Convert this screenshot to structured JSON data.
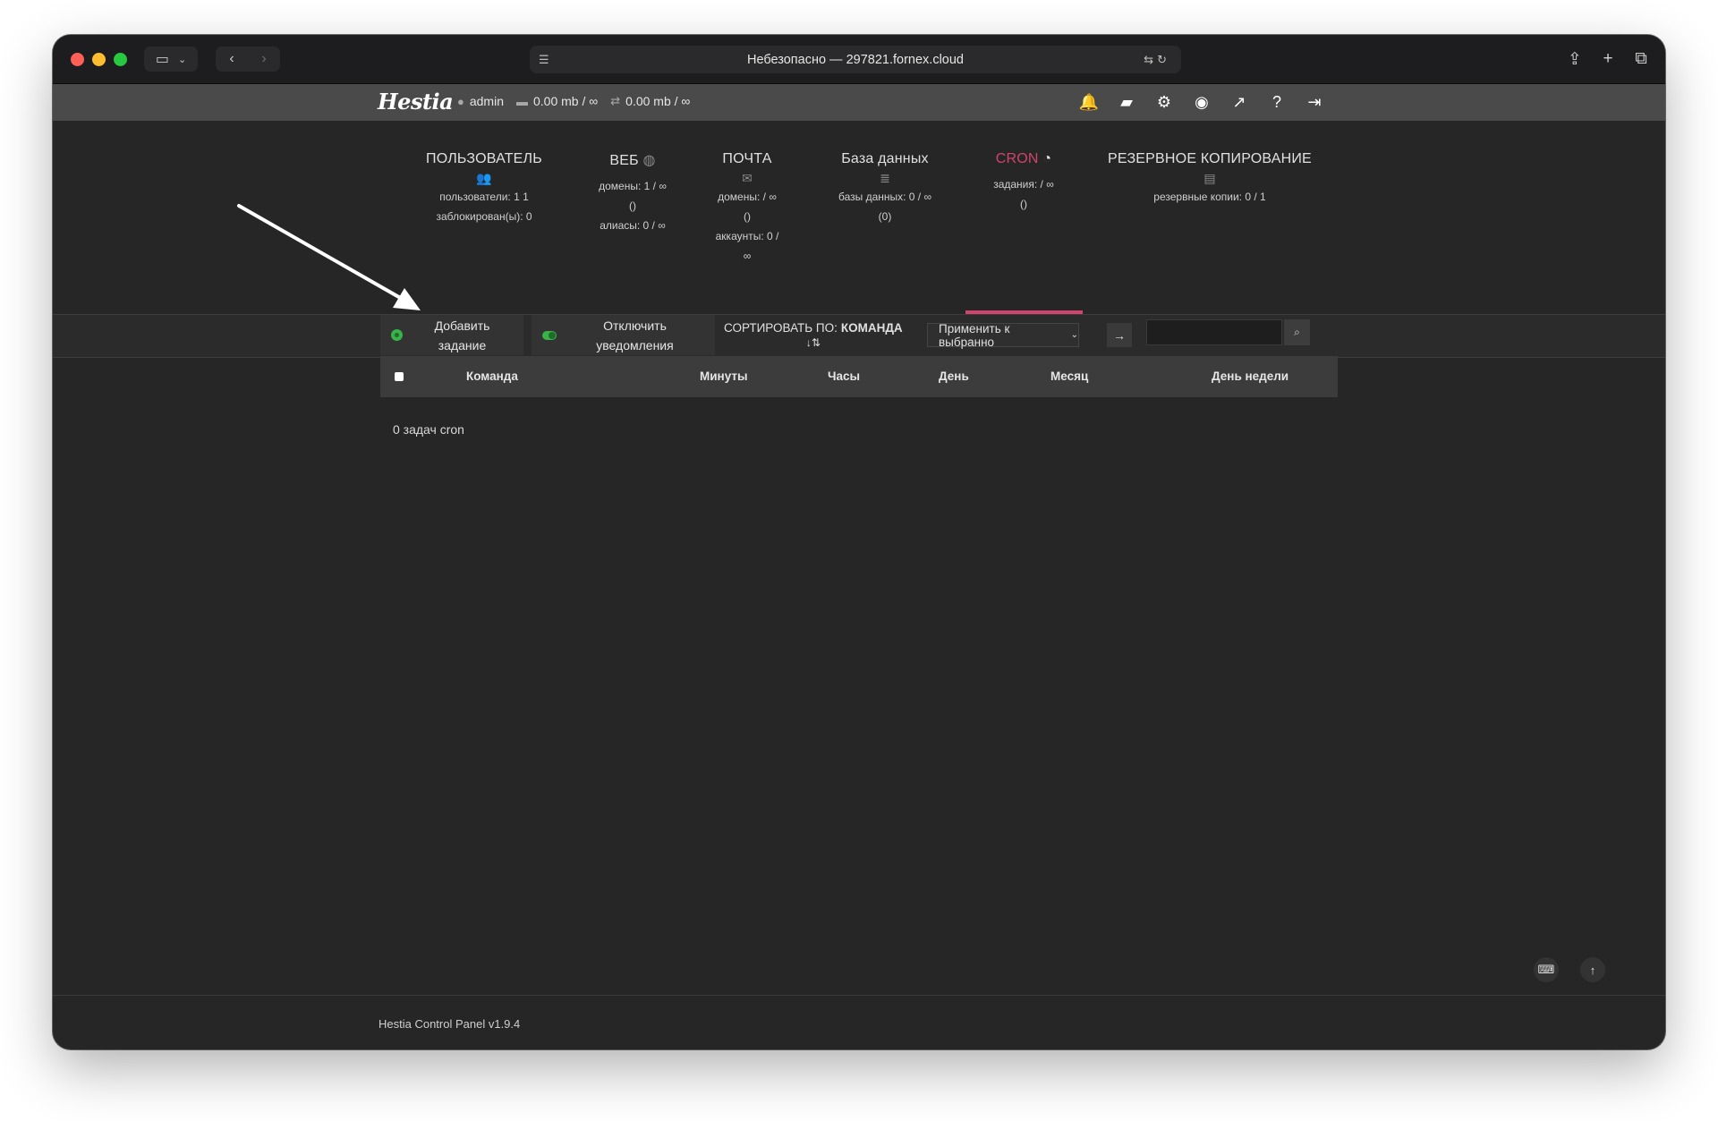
{
  "browser": {
    "address": "Небезопасно — 297821.fornex.cloud",
    "address_left_icon": "page-menu-icon",
    "address_right_icons": "translate-icon reload-icon"
  },
  "hestia": {
    "logo": "Hestia",
    "user": "admin",
    "disk": "0.00 mb / ∞",
    "bandwidth": "0.00 mb / ∞",
    "top_icons": [
      "bell-icon",
      "folder-icon",
      "gear-icon",
      "user-circle-icon",
      "chart-icon",
      "help-icon",
      "logout-icon"
    ]
  },
  "stats": [
    {
      "title": "ПОЛЬЗОВАТЕЛЬ",
      "lines": [
        "пользователи: 1 1",
        "заблокирован(ы): 0"
      ],
      "icon": "users-icon"
    },
    {
      "title": "ВЕБ",
      "lines": [
        "домены: 1 / ∞",
        "()",
        "алиасы: 0 / ∞"
      ],
      "icon": "globe-icon"
    },
    {
      "title": "ПОЧТА",
      "lines": [
        "домены: / ∞",
        "()",
        "аккаунты: 0 /",
        "∞"
      ],
      "icon": "mail-icon"
    },
    {
      "title": "База данных",
      "lines": [
        "базы данных: 0 / ∞",
        "(0)"
      ],
      "icon": "database-icon"
    },
    {
      "title": "CRON",
      "lines": [
        "задания: / ∞",
        "()"
      ],
      "icon": "clock-icon"
    },
    {
      "title": "РЕЗЕРВНОЕ КОПИРОВАНИЕ",
      "lines": [
        "резервные копии: 0 / 1"
      ],
      "icon": "file-icon"
    }
  ],
  "toolbar": {
    "add_job": "Добавить задание",
    "disable_notifications": "Отключить уведомления",
    "sort_label": "СОРТИРОВАТЬ ПО:",
    "sort_value": "КОМАНДА",
    "apply_select": "Применить к выбранно",
    "search_placeholder": ""
  },
  "table": {
    "columns": [
      "Команда",
      "Минуты",
      "Часы",
      "День",
      "Месяц",
      "День недели"
    ],
    "empty_text": "0 задач cron"
  },
  "footer": {
    "version": "Hestia Control Panel v1.9.4"
  },
  "colors": {
    "accent": "#d2436d",
    "green": "#38b34a",
    "bell": "#f1b232"
  }
}
